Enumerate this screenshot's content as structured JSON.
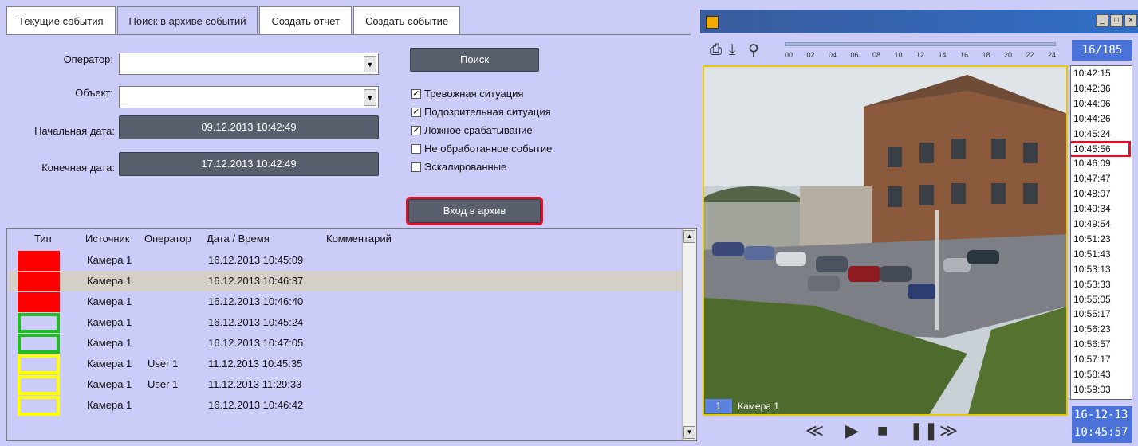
{
  "tabs": [
    "Текущие события",
    "Поиск в архиве событий",
    "Создать отчет",
    "Создать событие"
  ],
  "form": {
    "operator_label": "Оператор:",
    "object_label": "Объект:",
    "start_label": "Начальная дата:",
    "end_label": "Конечная дата:",
    "start_value": "09.12.2013 10:42:49",
    "end_value": "17.12.2013 10:42:49",
    "search_button": "Поиск",
    "archive_button": "Вход в архив"
  },
  "filters": [
    {
      "label": "Тревожная ситуация",
      "checked": true
    },
    {
      "label": "Подозрительная ситуация",
      "checked": true
    },
    {
      "label": "Ложное срабатывание",
      "checked": true
    },
    {
      "label": "Не обработанное событие",
      "checked": false
    },
    {
      "label": "Эскалированные",
      "checked": false
    }
  ],
  "table": {
    "headers": [
      "Тип",
      "Источник",
      "Оператор",
      "Дата / Время",
      "Комментарий"
    ],
    "rows": [
      {
        "type_color": "#ff0000",
        "type_style": "filled",
        "source": "Камера 1",
        "operator": "",
        "datetime": "16.12.2013 10:45:09",
        "selected": false
      },
      {
        "type_color": "#ff0000",
        "type_style": "filled",
        "source": "Камера 1",
        "operator": "",
        "datetime": "16.12.2013 10:46:37",
        "selected": true
      },
      {
        "type_color": "#ff0000",
        "type_style": "filled",
        "source": "Камера 1",
        "operator": "",
        "datetime": "16.12.2013 10:46:40",
        "selected": false
      },
      {
        "type_color": "#22bb22",
        "type_style": "outline",
        "source": "Камера 1",
        "operator": "",
        "datetime": "16.12.2013 10:45:24",
        "selected": false
      },
      {
        "type_color": "#22bb22",
        "type_style": "outline",
        "source": "Камера 1",
        "operator": "",
        "datetime": "16.12.2013 10:47:05",
        "selected": false
      },
      {
        "type_color": "#ffff00",
        "type_style": "outline",
        "source": "Камера 1",
        "operator": "User 1",
        "datetime": "11.12.2013 10:45:35",
        "selected": false
      },
      {
        "type_color": "#ffff00",
        "type_style": "outline",
        "source": "Камера 1",
        "operator": "User 1",
        "datetime": "11.12.2013 11:29:33",
        "selected": false
      },
      {
        "type_color": "#ffff00",
        "type_style": "outline",
        "source": "Камера 1",
        "operator": "",
        "datetime": "16.12.2013 10:46:42",
        "selected": false
      }
    ]
  },
  "player": {
    "counter": "16/185",
    "timeline_ticks": [
      "00",
      "02",
      "04",
      "06",
      "08",
      "10",
      "12",
      "14",
      "16",
      "18",
      "20",
      "22",
      "24"
    ],
    "times": [
      "10:42:15",
      "10:42:36",
      "10:44:06",
      "10:44:26",
      "10:45:24",
      "10:45:56",
      "10:46:09",
      "10:47:47",
      "10:48:07",
      "10:49:34",
      "10:49:54",
      "10:51:23",
      "10:51:43",
      "10:53:13",
      "10:53:33",
      "10:55:05",
      "10:55:17",
      "10:56:23",
      "10:56:57",
      "10:57:17",
      "10:58:43",
      "10:59:03"
    ],
    "selected_time_index": 5,
    "camera_number": "1",
    "camera_name": "Камера 1",
    "date_line1": "16-12-13",
    "date_line2": "10:45:57"
  },
  "colors": {
    "panel_bg": "#ccccf8",
    "button": "#5a5f6e",
    "accent_blue": "#4a72d8",
    "highlight": "#e0102a"
  },
  "window_buttons": [
    "_",
    "□",
    "×"
  ]
}
